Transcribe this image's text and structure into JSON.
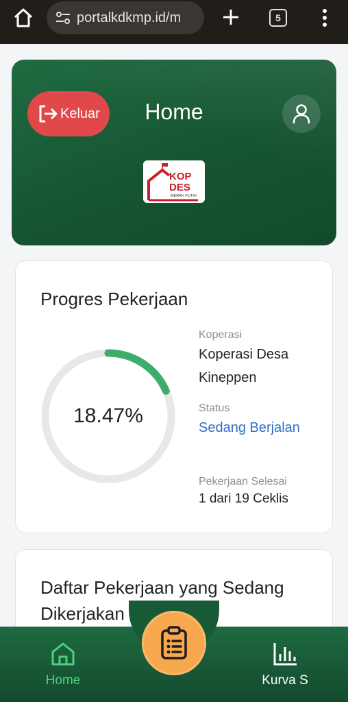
{
  "browser": {
    "url": "portalkdkmp.id/m",
    "tab_count": "5"
  },
  "header": {
    "logout_label": "Keluar",
    "title": "Home",
    "logo": {
      "line1": "KOP",
      "line2": "DES",
      "line3": "MERAH PUTIH"
    }
  },
  "progress": {
    "title": "Progres Pekerjaan",
    "percent_label": "18.47%",
    "percent_value": 18.47,
    "koperasi_label": "Koperasi",
    "koperasi_value": "Koperasi Desa Kineppen",
    "status_label": "Status",
    "status_value": "Sedang Berjalan",
    "done_label": "Pekerjaan Selesai",
    "done_value": "1 dari 19 Ceklis"
  },
  "tasks": {
    "title": "Daftar Pekerjaan yang Sedang Dikerjakan"
  },
  "bottom_nav": {
    "home_label": "Home",
    "kurva_label": "Kurva S"
  },
  "colors": {
    "header_green": "#165532",
    "logout_red": "#e0484a",
    "progress_green": "#3dad6a",
    "status_blue": "#2f6fc6",
    "fab_orange": "#f7a84f",
    "nav_active": "#4ed07f"
  }
}
